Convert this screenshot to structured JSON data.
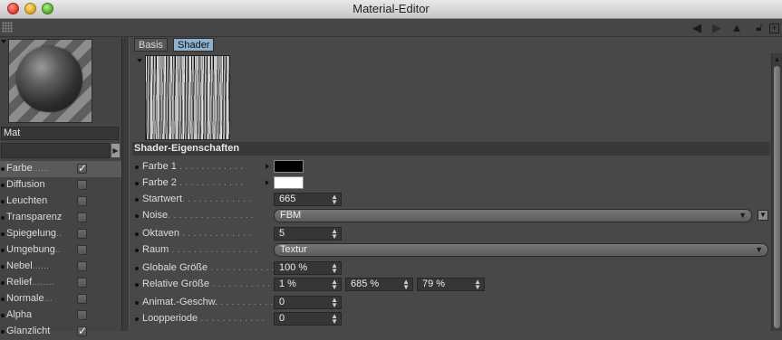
{
  "window": {
    "title": "Material-Editor"
  },
  "material": {
    "name": "Mat"
  },
  "channels": [
    {
      "label": "Farbe",
      "dots": "......",
      "checked": true,
      "active": true
    },
    {
      "label": "Diffusion",
      "dots": "",
      "checked": false
    },
    {
      "label": "Leuchten",
      "dots": "",
      "checked": false
    },
    {
      "label": "Transparenz",
      "dots": "",
      "checked": false
    },
    {
      "label": "Spiegelung",
      "dots": "..",
      "checked": false
    },
    {
      "label": "Umgebung",
      "dots": "..",
      "checked": false
    },
    {
      "label": "Nebel",
      "dots": "......",
      "checked": false
    },
    {
      "label": "Relief",
      "dots": "........",
      "checked": false
    },
    {
      "label": "Normale",
      "dots": "...",
      "checked": false
    },
    {
      "label": "Alpha",
      "dots": "",
      "checked": false
    },
    {
      "label": "Glanzlicht",
      "dots": "",
      "checked": true
    }
  ],
  "tabs": [
    {
      "label": "Basis"
    },
    {
      "label": "Shader",
      "selected": true
    }
  ],
  "section": {
    "title": "Shader-Eigenschaften"
  },
  "fields": {
    "farbe1": {
      "label": "Farbe 1",
      "dots": " . . . . . . . . . . . .",
      "color": "#000000"
    },
    "farbe2": {
      "label": "Farbe 2",
      "dots": " . . . . . . . . . . . .",
      "color": "#ffffff"
    },
    "startwert": {
      "label": "Startwert",
      "dots": ". . . . . . . . . . . . .",
      "value": "665"
    },
    "noise": {
      "label": "Noise",
      "dots": ". . . . . . . . . . . . . . . .",
      "value": "FBM"
    },
    "oktaven": {
      "label": "Oktaven",
      "dots": " . . . . . . . . . . . . .",
      "value": "5"
    },
    "raum": {
      "label": "Raum",
      "dots": " . . . . . . . . . . . . . . . .",
      "value": "Textur"
    },
    "globale": {
      "label": "Globale Größe",
      "dots": " . . . . . . . . . . . .",
      "value": "100 %"
    },
    "relative": {
      "label": "Relative Größe",
      "dots": " . . . . . . . . . . .",
      "values": [
        "1 %",
        "685 %",
        "79 %"
      ]
    },
    "animat": {
      "label": "Animat.-Geschw.",
      "dots": " . . . . . . . . . .",
      "value": "0"
    },
    "loop": {
      "label": "Loopperiode",
      "dots": " . . . . . . . . . . . .",
      "value": "0"
    }
  },
  "icons": {
    "toolbar": [
      "grip-icon",
      "back-arrow-icon",
      "forward-arrow-icon",
      "up-arrow-icon",
      "lock-icon",
      "new-window-icon"
    ]
  }
}
